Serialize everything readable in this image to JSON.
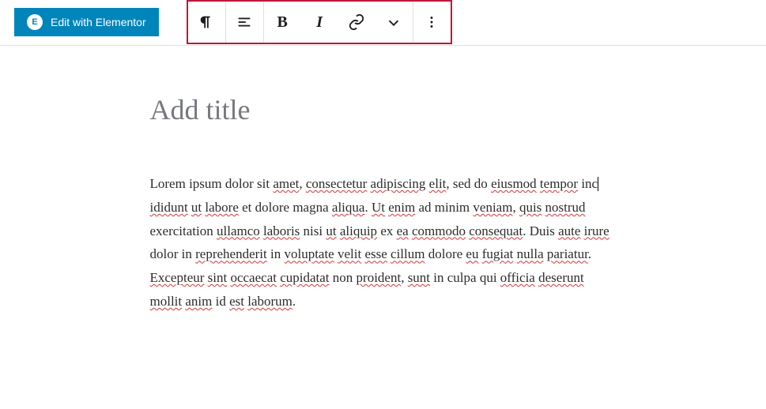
{
  "header": {
    "elementor_label": "Edit with Elementor",
    "elementor_icon_letter": "E"
  },
  "toolbar": {
    "icons": {
      "paragraph": "paragraph-icon",
      "align": "align-left-icon",
      "bold": "B",
      "italic": "I",
      "link": "link-icon",
      "more_inline": "chevron-down-icon",
      "more_options": "more-vertical-icon"
    }
  },
  "editor": {
    "title_placeholder": "Add title",
    "paragraph_segments": [
      {
        "t": "Lorem ipsum dolor sit ",
        "s": false
      },
      {
        "t": "amet",
        "s": true
      },
      {
        "t": ", ",
        "s": false
      },
      {
        "t": "consectetur",
        "s": true
      },
      {
        "t": " ",
        "s": false
      },
      {
        "t": "adipiscing",
        "s": true
      },
      {
        "t": " ",
        "s": false
      },
      {
        "t": "elit",
        "s": true
      },
      {
        "t": ", sed do ",
        "s": false
      },
      {
        "t": "eiusmod",
        "s": true
      },
      {
        "t": " ",
        "s": false
      },
      {
        "t": "tempor",
        "s": true
      },
      {
        "t": " inc",
        "s": false,
        "caret": true
      },
      {
        "t": "ididunt",
        "s": true
      },
      {
        "t": " ",
        "s": false
      },
      {
        "t": "ut",
        "s": true
      },
      {
        "t": " ",
        "s": false
      },
      {
        "t": "labore",
        "s": true
      },
      {
        "t": " et dolore magna ",
        "s": false
      },
      {
        "t": "aliqua",
        "s": true
      },
      {
        "t": ". ",
        "s": false
      },
      {
        "t": "Ut",
        "s": true
      },
      {
        "t": " ",
        "s": false
      },
      {
        "t": "enim",
        "s": true
      },
      {
        "t": " ad minim ",
        "s": false
      },
      {
        "t": "veniam",
        "s": true
      },
      {
        "t": ", ",
        "s": false
      },
      {
        "t": "quis",
        "s": true
      },
      {
        "t": " ",
        "s": false
      },
      {
        "t": "nostrud",
        "s": true
      },
      {
        "t": " exercitation ",
        "s": false
      },
      {
        "t": "ullamco",
        "s": true
      },
      {
        "t": " ",
        "s": false
      },
      {
        "t": "laboris",
        "s": true
      },
      {
        "t": " nisi ",
        "s": false
      },
      {
        "t": "ut",
        "s": true
      },
      {
        "t": " ",
        "s": false
      },
      {
        "t": "aliquip",
        "s": true
      },
      {
        "t": " ex ",
        "s": false
      },
      {
        "t": "ea",
        "s": true
      },
      {
        "t": " ",
        "s": false
      },
      {
        "t": "commodo",
        "s": true
      },
      {
        "t": " ",
        "s": false
      },
      {
        "t": "consequat",
        "s": true
      },
      {
        "t": ". Duis ",
        "s": false
      },
      {
        "t": "aute",
        "s": true
      },
      {
        "t": " ",
        "s": false
      },
      {
        "t": "irure",
        "s": true
      },
      {
        "t": " dolor in ",
        "s": false
      },
      {
        "t": "reprehenderit",
        "s": true
      },
      {
        "t": " in ",
        "s": false
      },
      {
        "t": "voluptate",
        "s": true
      },
      {
        "t": " ",
        "s": false
      },
      {
        "t": "velit",
        "s": true
      },
      {
        "t": " ",
        "s": false
      },
      {
        "t": "esse",
        "s": true
      },
      {
        "t": " ",
        "s": false
      },
      {
        "t": "cillum",
        "s": true
      },
      {
        "t": " dolore ",
        "s": false
      },
      {
        "t": "eu",
        "s": true
      },
      {
        "t": " ",
        "s": false
      },
      {
        "t": "fugiat",
        "s": true
      },
      {
        "t": " ",
        "s": false
      },
      {
        "t": "nulla",
        "s": true
      },
      {
        "t": " ",
        "s": false
      },
      {
        "t": "pariatur",
        "s": true
      },
      {
        "t": ". ",
        "s": false
      },
      {
        "t": "Excepteur",
        "s": true
      },
      {
        "t": " ",
        "s": false
      },
      {
        "t": "sint",
        "s": true
      },
      {
        "t": " ",
        "s": false
      },
      {
        "t": "occaecat",
        "s": true
      },
      {
        "t": " ",
        "s": false
      },
      {
        "t": "cupidatat",
        "s": true
      },
      {
        "t": " non ",
        "s": false
      },
      {
        "t": "proident",
        "s": true
      },
      {
        "t": ", ",
        "s": false
      },
      {
        "t": "sunt",
        "s": true
      },
      {
        "t": " in culpa qui ",
        "s": false
      },
      {
        "t": "officia",
        "s": true
      },
      {
        "t": " ",
        "s": false
      },
      {
        "t": "deserunt",
        "s": true
      },
      {
        "t": " ",
        "s": false
      },
      {
        "t": "mollit",
        "s": true
      },
      {
        "t": " ",
        "s": false
      },
      {
        "t": "anim",
        "s": true
      },
      {
        "t": " id ",
        "s": false
      },
      {
        "t": "est",
        "s": true
      },
      {
        "t": " ",
        "s": false
      },
      {
        "t": "laborum",
        "s": true
      },
      {
        "t": ".",
        "s": false
      }
    ]
  }
}
